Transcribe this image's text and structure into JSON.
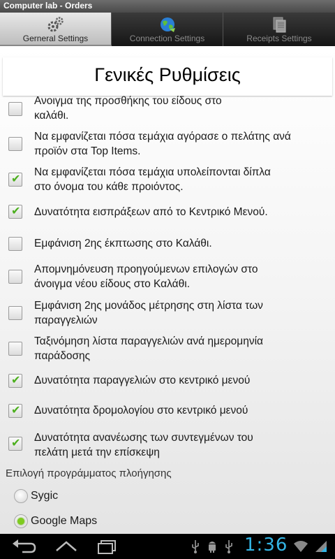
{
  "window": {
    "title": "Computer lab - Orders"
  },
  "tabs": [
    {
      "label": "Gerneral Settings",
      "icon": "gears-icon",
      "active": true
    },
    {
      "label": "Connection Settings",
      "icon": "globe-icon",
      "active": false
    },
    {
      "label": "Receipts Settings",
      "icon": "documents-icon",
      "active": false
    }
  ],
  "page": {
    "heading": "Γενικές Ρυθμίσεις"
  },
  "settings": {
    "items": [
      {
        "line1": "Ανοιγμα της προσθήκης του είδους στο",
        "line2": "καλάθι.",
        "checked": false
      },
      {
        "line1": "Να εμφανίζεται πόσα τεμάχια αγόρασε ο πελάτης ανά",
        "line2": "προϊόν στα Top Items.",
        "checked": false
      },
      {
        "line1": "Να εμφανίζεται πόσα τεμάχια υπολείπονται δίπλα",
        "line2": "στο όνομα του κάθε προιόντος.",
        "checked": true
      },
      {
        "line1": "Δυνατότητα εισπράξεων από το Κεντρικό Μενού.",
        "line2": "",
        "checked": true
      },
      {
        "line1": "Εμφάνιση 2ης έκπτωσης στο Καλάθι.",
        "line2": "",
        "checked": false
      },
      {
        "line1": "Απομνημόνευση προηγούμενων επιλογών στο",
        "line2": "άνοιγμα νέου είδους στο Καλάθι.",
        "checked": false
      },
      {
        "line1": "Εμφάνιση 2ης μονάδος μέτρησης στη λίστα των",
        "line2": "παραγγελιών",
        "checked": false
      },
      {
        "line1": "Ταξινόμηση λίστα παραγγελιών ανά ημερομηνία",
        "line2": "παράδοσης",
        "checked": false
      },
      {
        "line1": "Δυνατότητα παραγγελιών στο κεντρικό μενού",
        "line2": "",
        "checked": true
      },
      {
        "line1": "Δυνατότητα δρομολογίου στο κεντρικό μενού",
        "line2": "",
        "checked": true
      },
      {
        "line1": "Δυνατότητα ανανέωσης των συντεγμένων του",
        "line2": "πελάτη μετά την επίσκεψη",
        "checked": true
      }
    ]
  },
  "navigation": {
    "label": "Επιλογή προγράμματος πλοήγησης",
    "options": [
      {
        "label": "Sygic",
        "selected": false
      },
      {
        "label": "Google Maps",
        "selected": true
      }
    ]
  },
  "system": {
    "clock": "1:36",
    "accent": "#33b5e5",
    "check_color": "#4caf1e"
  }
}
